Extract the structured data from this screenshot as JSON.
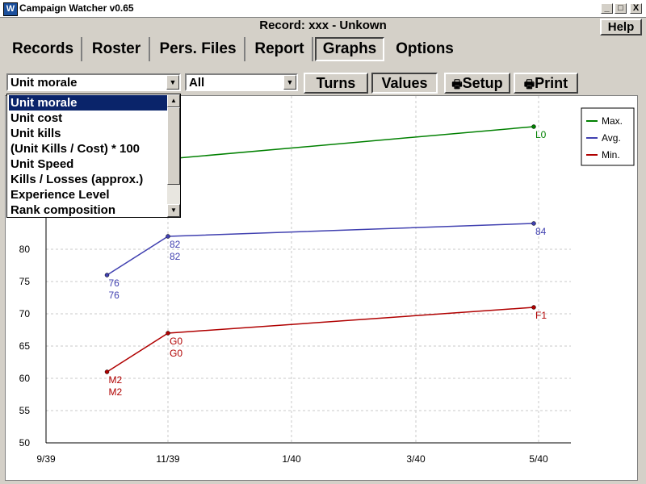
{
  "window": {
    "title": "Campaign Watcher v0.65",
    "icon": "app-icon",
    "minimize_glyph": "_",
    "maximize_glyph": "□",
    "close_glyph": "X"
  },
  "header": {
    "record_line": "Record: xxx - Unkown",
    "help_label": "Help"
  },
  "tabs": [
    {
      "label": "Records"
    },
    {
      "label": "Roster"
    },
    {
      "label": "Pers. Files"
    },
    {
      "label": "Report"
    },
    {
      "label": "Graphs",
      "active": true
    },
    {
      "label": "Options"
    }
  ],
  "controls": {
    "metric_select": "Unit morale",
    "filter_select": "All",
    "turns_label": "Turns",
    "values_label": "Values",
    "setup_label": "Setup",
    "print_label": "Print"
  },
  "dropdown": {
    "options": [
      "Unit morale",
      "Unit cost",
      "Unit kills",
      "(Unit Kills / Cost) * 100",
      "Unit Speed",
      "Kills / Losses (approx.)",
      "Experience Level",
      "Rank composition"
    ],
    "selected_index": 0
  },
  "chart_data": {
    "type": "line",
    "x_tick_labels": [
      "9/39",
      "11/39",
      "1/40",
      "3/40",
      "5/40"
    ],
    "y_tick_labels": [
      "50",
      "55",
      "60",
      "65",
      "70",
      "75",
      "80"
    ],
    "ylim": [
      50,
      98
    ],
    "grid": true,
    "legend_position": "top-right",
    "series": [
      {
        "name": "Max.",
        "color": "#008000",
        "points": [
          {
            "x": "11/39",
            "y": 94,
            "label": ""
          },
          {
            "x": "5/40",
            "y": 99,
            "label": "L0"
          }
        ]
      },
      {
        "name": "Avg.",
        "color": "#4040b0",
        "points": [
          {
            "x": "10/39",
            "y": 76,
            "label": "76"
          },
          {
            "x": "11/39",
            "y": 82,
            "label": "82"
          },
          {
            "x": "5/40",
            "y": 84,
            "label": "84"
          }
        ]
      },
      {
        "name": "Min.",
        "color": "#b00000",
        "points": [
          {
            "x": "10/39",
            "y": 61,
            "label": "M2"
          },
          {
            "x": "11/39",
            "y": 67,
            "label": "G0"
          },
          {
            "x": "5/40",
            "y": 71,
            "label": "F1"
          }
        ]
      }
    ]
  }
}
